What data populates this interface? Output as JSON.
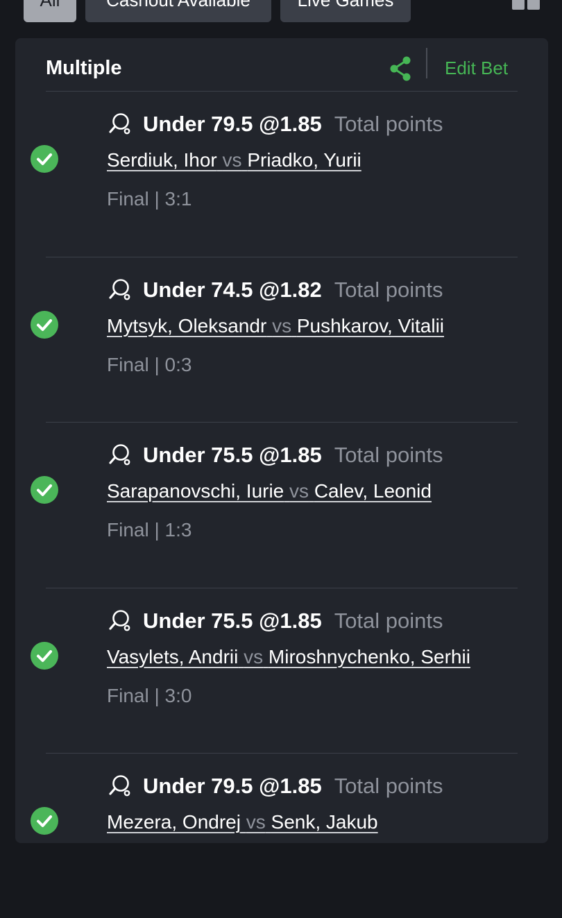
{
  "filter_tabs": [
    {
      "label": "All",
      "active": true
    },
    {
      "label": "Cashout Available",
      "active": false
    },
    {
      "label": "Live Games",
      "active": false
    }
  ],
  "view_toggle_icon": "grid-view-icon",
  "card": {
    "title": "Multiple",
    "share_icon": "share-icon",
    "edit_label": "Edit Bet"
  },
  "colors": {
    "accent_green": "#46b655",
    "check_green": "#4bb659",
    "background": "#16181d",
    "card": "#22252c",
    "muted_text": "#8f939c"
  },
  "legs": [
    {
      "sport_icon": "table-tennis-icon",
      "status_icon": "check-circle-icon",
      "selection": "Under 79.5 @1.85",
      "market": "Total points",
      "home": "Serdiuk, Ihor",
      "vs": "vs",
      "away": "Priadko, Yurii",
      "result": "Final | 3:1"
    },
    {
      "sport_icon": "table-tennis-icon",
      "status_icon": "check-circle-icon",
      "selection": "Under 74.5 @1.82",
      "market": "Total points",
      "home": "Mytsyk, Oleksandr",
      "vs": "vs",
      "away": "Pushkarov, Vitalii",
      "result": "Final | 0:3"
    },
    {
      "sport_icon": "table-tennis-icon",
      "status_icon": "check-circle-icon",
      "selection": "Under 75.5 @1.85",
      "market": "Total points",
      "home": "Sarapanovschi, Iurie",
      "vs": "vs",
      "away": "Calev, Leonid",
      "result": "Final | 1:3"
    },
    {
      "sport_icon": "table-tennis-icon",
      "status_icon": "check-circle-icon",
      "selection": "Under 75.5 @1.85",
      "market": "Total points",
      "home": "Vasylets, Andrii",
      "vs": "vs",
      "away": "Miroshnychenko, Serhii",
      "result": "Final | 3:0"
    },
    {
      "sport_icon": "table-tennis-icon",
      "status_icon": "check-circle-icon",
      "selection": "Under 79.5 @1.85",
      "market": "Total points",
      "home": "Mezera, Ondrej",
      "vs": "vs",
      "away": "Senk, Jakub",
      "result": ""
    }
  ]
}
